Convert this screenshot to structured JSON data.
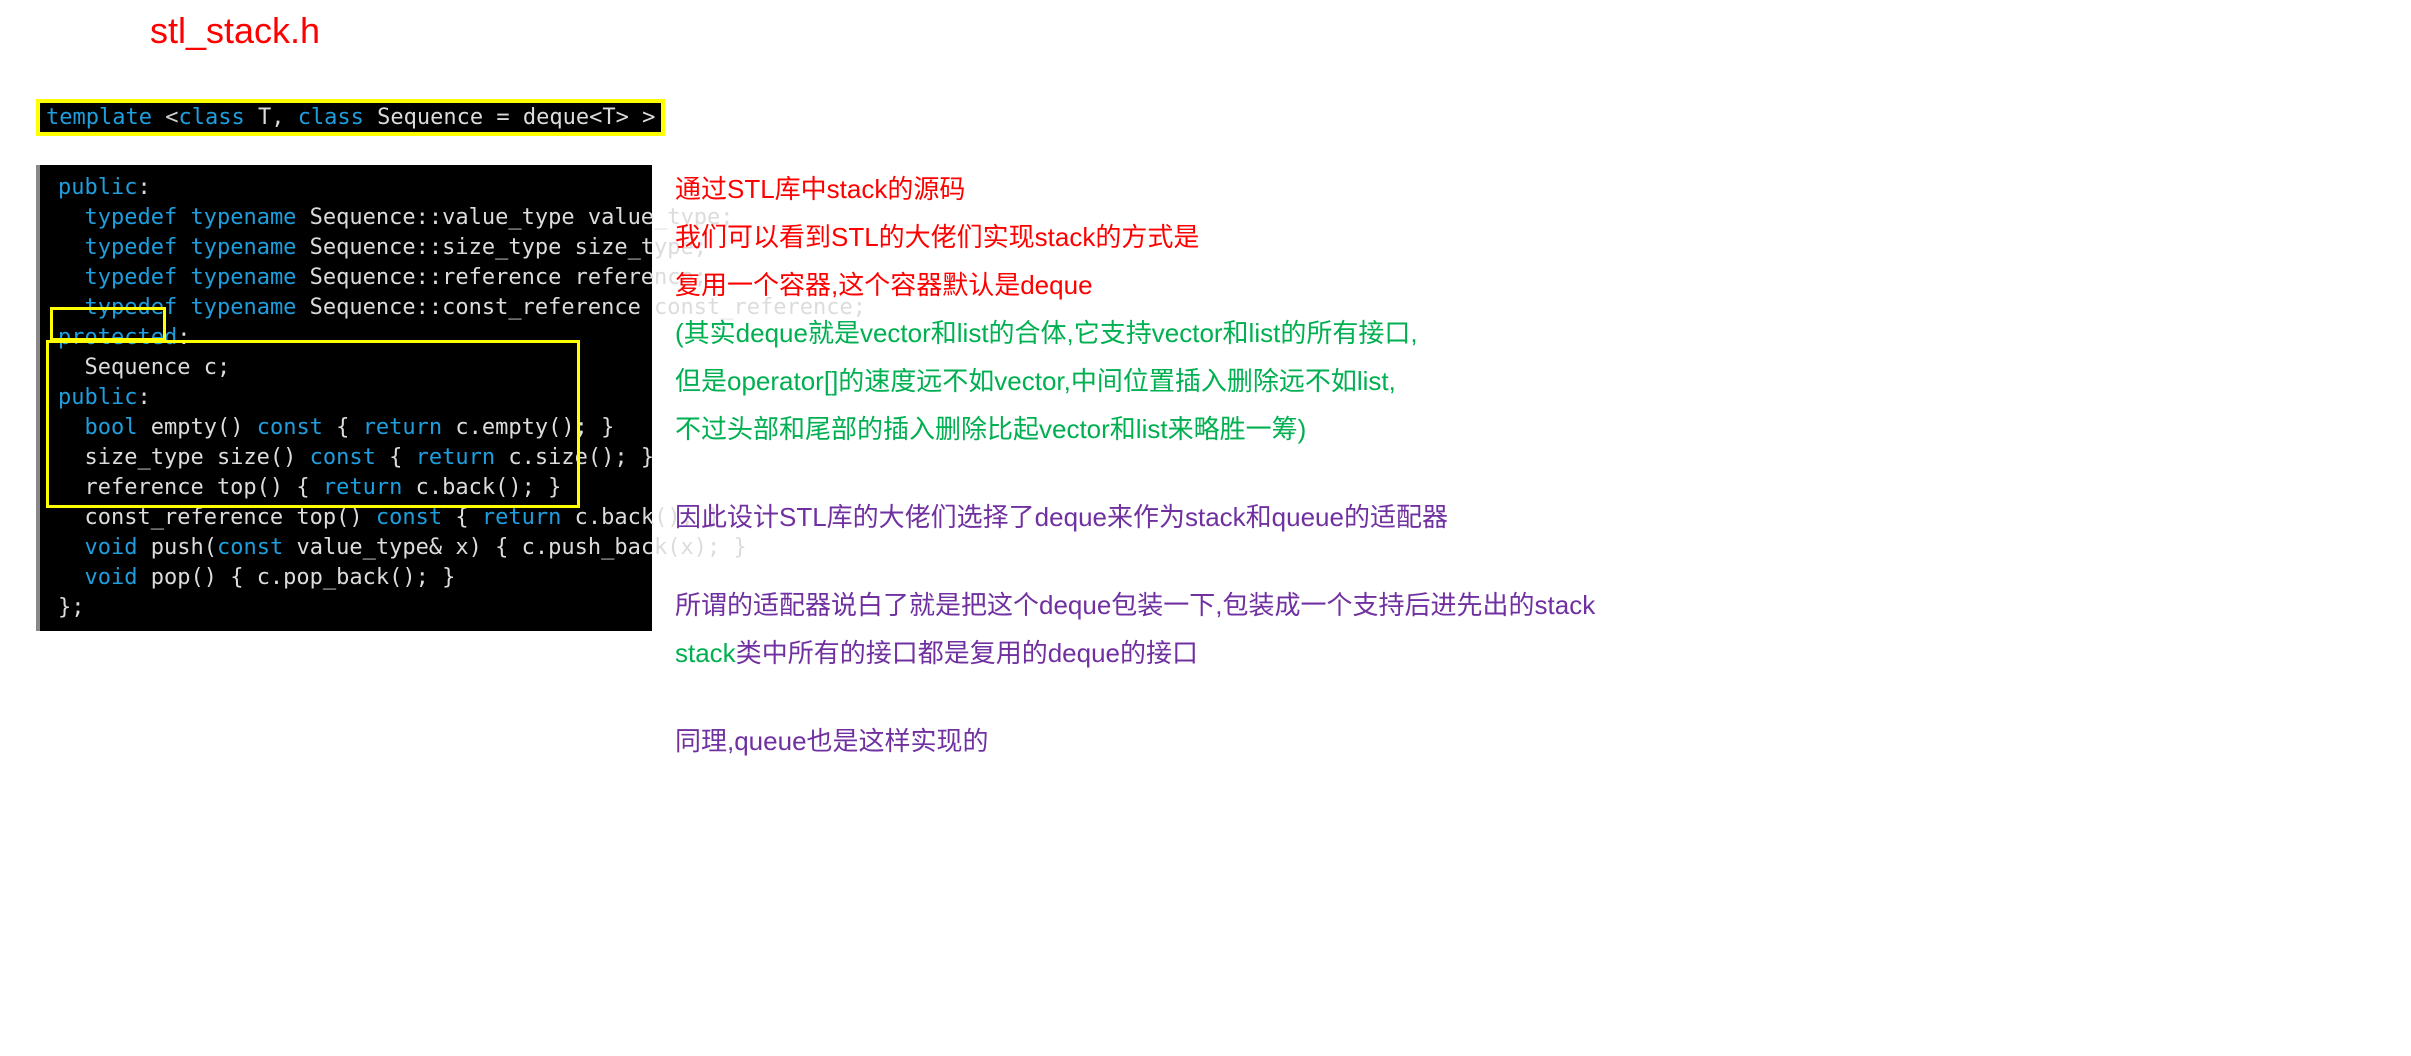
{
  "title": "stl_stack.h",
  "template_line": {
    "p1": "template",
    "p2": " <",
    "p3": "class",
    "p4": " T, ",
    "p5": "class",
    "p6": " Sequence = deque<T> >"
  },
  "code": {
    "l1": "public",
    "l1b": ":",
    "typedef": "typedef",
    "typename": "typename",
    "t1": " Sequence::value_type value_type;",
    "t2": " Sequence::size_type size_type;",
    "t3": " Sequence::reference reference;",
    "t4": " Sequence::const_reference const_reference;",
    "prot": "protected",
    "protb": ":",
    "seq": "  Sequence c;",
    "pub2": "public",
    "pub2b": ":",
    "f1a": "  bool",
    "f1b": " empty() ",
    "f1c": "const",
    "f1d": " { ",
    "f1e": "return",
    "f1f": " c.empty(); }",
    "f2a": "  size_type size() ",
    "f2b": "const",
    "f2c": " { ",
    "f2d": "return",
    "f2e": " c.size(); }",
    "f3a": "  reference top() { ",
    "f3b": "return",
    "f3c": " c.back(); }",
    "f4a": "  const_reference top() ",
    "f4b": "const",
    "f4c": " { ",
    "f4d": "return",
    "f4e": " c.back(); }",
    "f5a": "  void",
    "f5b": " push(",
    "f5c": "const",
    "f5d": " value_type& x) { c.push_back(x); }",
    "f6a": "  void",
    "f6b": " pop() { c.pop_back(); }",
    "end": "};"
  },
  "notes": {
    "r1": "通过STL库中stack的源码",
    "r2": "我们可以看到STL的大佬们实现stack的方式是",
    "r3": "复用一个容器,这个容器默认是deque",
    "g1": "(其实deque就是vector和list的合体,它支持vector和list的所有接口,",
    "g2": "但是operator[]的速度远不如vector,中间位置插入删除远不如list,",
    "g3": "不过头部和尾部的插入删除比起vector和list来略胜一筹)",
    "p1": "因此设计STL库的大佬们选择了deque来作为stack和queue的适配器",
    "p2a": "所谓的适配器说白了就是把这个deque包装一下,包装成一个支持后进先出的stack",
    "p2b_green": "stack",
    "p2b_purple": "类中所有的接口都是复用的deque的接口",
    "p3": "同理,queue也是这样实现的"
  }
}
